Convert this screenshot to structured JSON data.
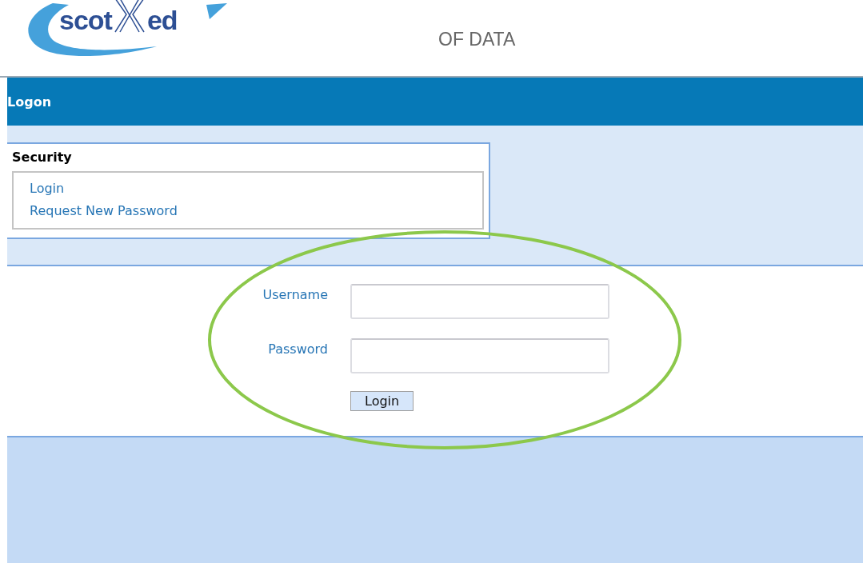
{
  "logo": {
    "word_1": "scot",
    "word_2": "ed"
  },
  "tagline": "OF DATA",
  "title_bar": {
    "title": "Logon"
  },
  "security": {
    "heading": "Security",
    "links": [
      "Login",
      "Request New Password"
    ]
  },
  "form": {
    "fields": [
      {
        "label": "Username"
      },
      {
        "label": "Password"
      }
    ],
    "submit": "Login"
  },
  "annotation": {
    "kind": "ellipse",
    "color": "#8cc84b"
  }
}
